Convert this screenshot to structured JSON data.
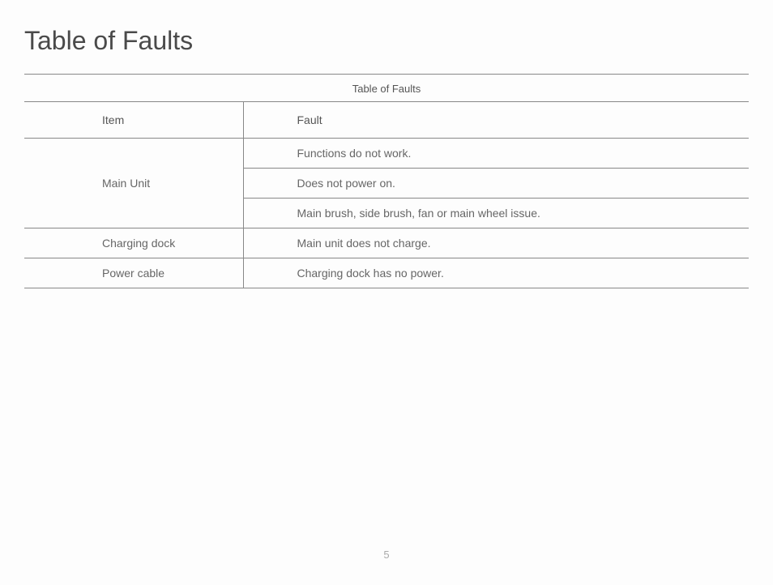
{
  "title": "Table of Faults",
  "table": {
    "caption": "Table of Faults",
    "headers": {
      "item": "Item",
      "fault": "Fault"
    },
    "rows": [
      {
        "item": "Main Unit",
        "faults": [
          "Functions do not work.",
          "Does not power on.",
          "Main brush, side brush, fan or main wheel issue."
        ]
      },
      {
        "item": "Charging dock",
        "faults": [
          "Main unit does not charge."
        ]
      },
      {
        "item": "Power cable",
        "faults": [
          "Charging dock has no power."
        ]
      }
    ]
  },
  "pageNumber": "5"
}
